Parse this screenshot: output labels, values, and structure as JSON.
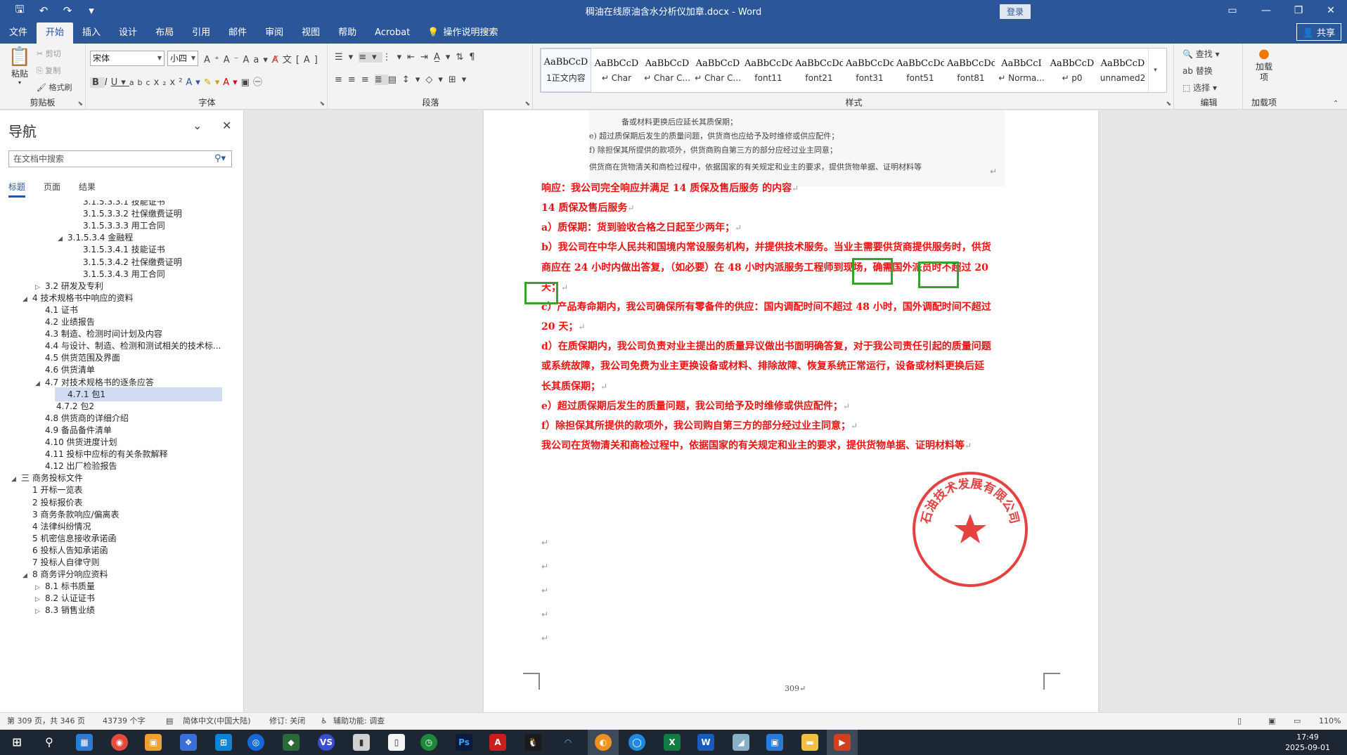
{
  "window": {
    "title": "稠油在线原油含水分析仪加章.docx - Word",
    "login_label": "登录"
  },
  "tabs": [
    "文件",
    "开始",
    "插入",
    "设计",
    "布局",
    "引用",
    "邮件",
    "审阅",
    "视图",
    "帮助",
    "Acrobat"
  ],
  "tell_me": "操作说明搜索",
  "share_label": "共享",
  "ribbon": {
    "clipboard": {
      "label": "剪贴板",
      "paste": "粘贴",
      "cut": "剪切",
      "copy": "复制",
      "format_painter": "格式刷"
    },
    "font": {
      "label": "字体",
      "font_name": "宋体",
      "font_size": "小四"
    },
    "paragraph": {
      "label": "段落"
    },
    "styles": {
      "label": "样式",
      "items": [
        {
          "sample": "AaBbCcD",
          "name": "1正文内容"
        },
        {
          "sample": "AaBbCcD",
          "name": "↵ Char"
        },
        {
          "sample": "AaBbCcD",
          "name": "↵ Char C..."
        },
        {
          "sample": "AaBbCcD",
          "name": "↵ Char C..."
        },
        {
          "sample": "AaBbCcDdI",
          "name": "font11"
        },
        {
          "sample": "AaBbCcDdE",
          "name": "font21"
        },
        {
          "sample": "AaBbCcDdEe",
          "name": "font31"
        },
        {
          "sample": "AaBbCcDdEe",
          "name": "font51"
        },
        {
          "sample": "AaBbCcDdEe",
          "name": "font81"
        },
        {
          "sample": "AaBbCcI",
          "name": "↵ Norma..."
        },
        {
          "sample": "AaBbCcD",
          "name": "↵ p0"
        },
        {
          "sample": "AaBbCcD",
          "name": "unnamed2"
        }
      ]
    },
    "editing": {
      "label": "编辑",
      "find": "查找",
      "replace": "替换",
      "select": "选择"
    },
    "addins": {
      "label": "加载项",
      "button": "加载项"
    }
  },
  "nav": {
    "title": "导航",
    "search_placeholder": "在文档中搜索",
    "tabs": [
      "标题",
      "页面",
      "结果"
    ],
    "items": [
      {
        "text": "3.1.5.3.3.1 技能证书",
        "level": 5,
        "tri": ""
      },
      {
        "text": "3.1.5.3.3.2 社保缴费证明",
        "level": 5,
        "tri": ""
      },
      {
        "text": "3.1.5.3.3.3 用工合同",
        "level": 5,
        "tri": ""
      },
      {
        "text": "3.1.5.3.4 金融程",
        "level": 4,
        "tri": "◢"
      },
      {
        "text": "3.1.5.3.4.1 技能证书",
        "level": 5,
        "tri": ""
      },
      {
        "text": "3.1.5.3.4.2 社保缴费证明",
        "level": 5,
        "tri": ""
      },
      {
        "text": "3.1.5.3.4.3 用工合同",
        "level": 5,
        "tri": ""
      },
      {
        "text": "3.2 研发及专利",
        "level": 2,
        "tri": "▷"
      },
      {
        "text": "4 技术规格书中响应的资料",
        "level": 1,
        "tri": "◢"
      },
      {
        "text": "4.1 证书",
        "level": 2,
        "tri": ""
      },
      {
        "text": "4.2 业绩报告",
        "level": 2,
        "tri": ""
      },
      {
        "text": "4.3 制造、检测时间计划及内容",
        "level": 2,
        "tri": ""
      },
      {
        "text": "4.4 与设计、制造、检测和测试相关的技术标...",
        "level": 2,
        "tri": ""
      },
      {
        "text": "4.5 供货范围及界面",
        "level": 2,
        "tri": ""
      },
      {
        "text": "4.6 供货清单",
        "level": 2,
        "tri": ""
      },
      {
        "text": "4.7 对技术规格书的逐条应答",
        "level": 2,
        "tri": "◢"
      },
      {
        "text": "4.7.1 包1",
        "level": 3,
        "tri": "",
        "selected": true
      },
      {
        "text": "4.7.2 包2",
        "level": 3,
        "tri": ""
      },
      {
        "text": "4.8 供货商的详细介绍",
        "level": 2,
        "tri": ""
      },
      {
        "text": "4.9 备品备件清单",
        "level": 2,
        "tri": ""
      },
      {
        "text": "4.10 供货进度计划",
        "level": 2,
        "tri": ""
      },
      {
        "text": "4.11 投标中应标的有关条款解释",
        "level": 2,
        "tri": ""
      },
      {
        "text": "4.12 出厂检验报告",
        "level": 2,
        "tri": ""
      },
      {
        "text": "三 商务投标文件",
        "level": 0,
        "tri": "◢"
      },
      {
        "text": "1 开标一览表",
        "level": 1,
        "tri": ""
      },
      {
        "text": "2 投标报价表",
        "level": 1,
        "tri": ""
      },
      {
        "text": "3 商务条款响应/偏离表",
        "level": 1,
        "tri": ""
      },
      {
        "text": "4 法律纠纷情况",
        "level": 1,
        "tri": ""
      },
      {
        "text": "5 机密信息接收承诺函",
        "level": 1,
        "tri": ""
      },
      {
        "text": "6 投标人告知承诺函",
        "level": 1,
        "tri": ""
      },
      {
        "text": "7 投标人自律守则",
        "level": 1,
        "tri": ""
      },
      {
        "text": "8 商务评分响应资料",
        "level": 1,
        "tri": "◢"
      },
      {
        "text": "8.1 标书质量",
        "level": 2,
        "tri": "▷"
      },
      {
        "text": "8.2 认证证书",
        "level": 2,
        "tri": "▷"
      },
      {
        "text": "8.3 销售业绩",
        "level": 2,
        "tri": "▷"
      }
    ]
  },
  "document": {
    "scan_lines": [
      "备或材料更换后应延长其质保期；",
      "e)    超过质保期后发生的质量问题，供货商也应给予及时维修或供应配件；",
      "f)    除担保其所提供的款项外，供货商购自第三方的部分应经过业主同意；",
      "供货商在货物清关和商检过程中，依据国家的有关规定和业主的要求，提供货物单据、证明材料等"
    ],
    "red_lines": [
      "响应：我公司完全响应并满足  14  质保及售后服务  的内容",
      "14  质保及售后服务",
      "a）质保期：货到验收合格之日起至少两年；",
      "b）我公司在中华人民共和国境内常设服务机构，并提供技术服务。当业主需要供货商提供服务时，供货",
      "商应在 24 小时内做出答复，（如必要）在 48 小时内派服务工程师到现场，确需国外派员时不超过 20",
      "天；",
      "c）产品寿命期内，我公司确保所有零备件的供应：国内调配时间不超过 48 小时，国外调配时间不超过",
      "20 天；",
      "d）在质保期内，我公司负责对业主提出的质量异议做出书面明确答复，对于我公司责任引起的质量问题",
      "或系统故障，我公司免费为业主更换设备或材料、排除故障、恢复系统正常运行，设备或材料更换后延",
      "长其质保期；",
      "e）超过质保期后发生的质量问题，我公司给予及时维修或供应配件；",
      "f）除担保其所提供的款项外，我公司购自第三方的部分经过业主同意；",
      "我公司在货物清关和商检过程中，依据国家的有关规定和业主的要求，提供货物单据、证明材料等"
    ],
    "paragraph_mark": "↵",
    "page_number": "309",
    "stamp_text": "石油技术发展有限公司"
  },
  "status": {
    "page": "第 309 页，共 346 页",
    "words": "43739 个字",
    "language": "简体中文(中国大陆)",
    "track": "修订: 关闭",
    "accessibility": "辅助功能: 调查",
    "zoom": "110%"
  },
  "taskbar": {
    "time": "17:49",
    "date": "2025-09-01"
  },
  "colors": {
    "brand": "#2b579a",
    "red_text": "#ee1111",
    "highlight_box": "#3aa02c",
    "stamp": "#e02020"
  }
}
